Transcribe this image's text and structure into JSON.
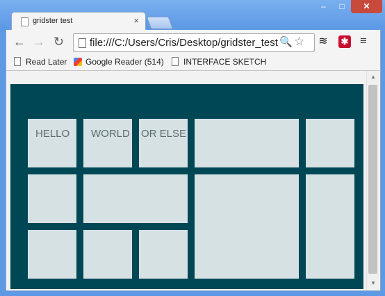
{
  "window": {
    "tab_title": "gridster test",
    "close_tab": "×",
    "minimize": "–",
    "maximize": "□",
    "close": "✕"
  },
  "toolbar": {
    "back": "←",
    "forward": "→",
    "reload": "↻",
    "url": "file:///C:/Users/Cris/Desktop/gridster_test",
    "search_glyph": "🔍",
    "star_glyph": "☆",
    "ext1_glyph": "≋",
    "ext2_glyph": "✱",
    "menu_glyph": "≡"
  },
  "bookmarks": [
    {
      "label": "Read Later"
    },
    {
      "label": "Google Reader (514)"
    },
    {
      "label": "INTERFACE SKETCH"
    }
  ],
  "widgets": [
    {
      "label": "HELLO"
    },
    {
      "label": "WORLD"
    },
    {
      "label": "OR ELSE"
    },
    {
      "label": ""
    },
    {
      "label": ""
    },
    {
      "label": ""
    },
    {
      "label": ""
    },
    {
      "label": ""
    },
    {
      "label": ""
    },
    {
      "label": ""
    },
    {
      "label": ""
    },
    {
      "label": ""
    }
  ],
  "colors": {
    "grid_background": "#004756",
    "widget_background": "#d6e1e4",
    "chrome_frame": "#5d99e5"
  },
  "scrollbar": {
    "up": "▲",
    "down": "▼"
  }
}
